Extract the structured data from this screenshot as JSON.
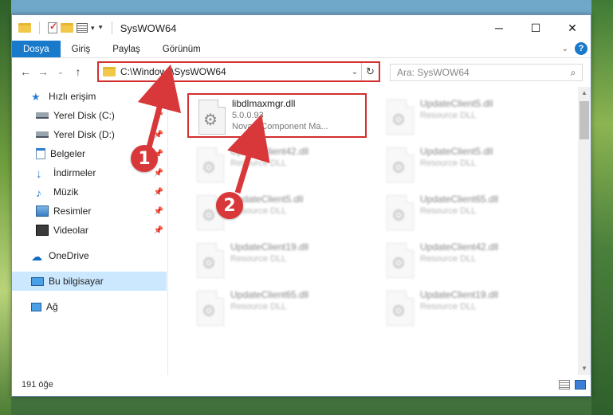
{
  "window": {
    "title": "SysWOW64",
    "controls": {
      "minimize": "─",
      "maximize": "☐",
      "close": "✕"
    }
  },
  "ribbon": {
    "tabs": [
      "Dosya",
      "Giriş",
      "Paylaş",
      "Görünüm"
    ]
  },
  "address": {
    "path": "C:\\Windows\\SysWOW64",
    "search_placeholder": "Ara: SysWOW64"
  },
  "sidebar": {
    "items": [
      {
        "label": "Hızlı erişim",
        "icon": "star-icon",
        "pinned": false
      },
      {
        "label": "Yerel Disk (C:)",
        "icon": "drive-icon",
        "pinned": true
      },
      {
        "label": "Yerel Disk (D:)",
        "icon": "drive-icon",
        "pinned": true
      },
      {
        "label": "Belgeler",
        "icon": "documents-icon",
        "pinned": true
      },
      {
        "label": "İndirmeler",
        "icon": "download-icon",
        "pinned": true
      },
      {
        "label": "Müzik",
        "icon": "music-icon",
        "pinned": true
      },
      {
        "label": "Resimler",
        "icon": "pictures-icon",
        "pinned": true
      },
      {
        "label": "Videolar",
        "icon": "videos-icon",
        "pinned": true
      },
      {
        "label": "OneDrive",
        "icon": "onedrive-icon",
        "pinned": false
      },
      {
        "label": "Bu bilgisayar",
        "icon": "computer-icon",
        "pinned": false,
        "selected": true
      },
      {
        "label": "Ağ",
        "icon": "network-icon",
        "pinned": false
      }
    ]
  },
  "files": {
    "highlighted": {
      "name": "libdlmaxmgr.dll",
      "version": "5.0.0.93",
      "description": "Nova's Component Ma..."
    },
    "blurred": [
      {
        "name": "UpdateClient5.dll",
        "type": "Resource DLL"
      },
      {
        "name": "UpdateClient42.dll",
        "type": "Resource DLL"
      },
      {
        "name": "UpdateClient5.dll",
        "type": "Resource DLL"
      },
      {
        "name": "UpdateClient5.dll",
        "type": "Resource DLL"
      },
      {
        "name": "UpdateClient65.dll",
        "type": "Resource DLL"
      },
      {
        "name": "UpdateClient19.dll",
        "type": "Resource DLL"
      },
      {
        "name": "UpdateClient42.dll",
        "type": "Resource DLL"
      },
      {
        "name": "UpdateClient65.dll",
        "type": "Resource DLL"
      },
      {
        "name": "UpdateClient19.dll",
        "type": "Resource DLL"
      }
    ]
  },
  "status": {
    "count": "191 öğe"
  },
  "annotations": {
    "step1": "1",
    "step2": "2",
    "color": "#d32f2f"
  }
}
